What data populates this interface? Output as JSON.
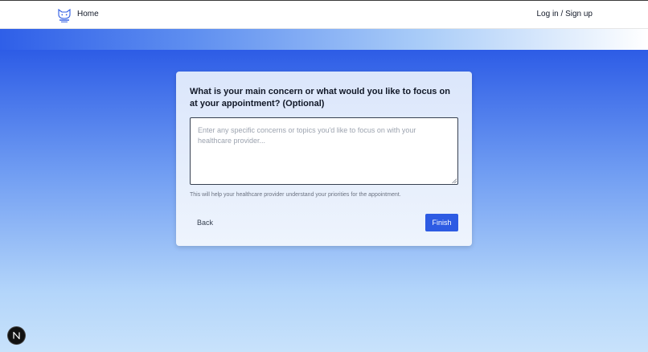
{
  "nav": {
    "logo_icon": "cat-logo-icon",
    "home_label": "Home",
    "login_label": "Log in / Sign up"
  },
  "card": {
    "title": "What is your main concern or what would you like to focus on at your appointment? (Optional)",
    "input_value": "",
    "input_placeholder": "Enter any specific concerns or topics you'd like to focus on with your healthcare provider...",
    "help_text": "This will help your healthcare provider understand your priorities for the appointment.",
    "back_label": "Back",
    "finish_label": "Finish"
  },
  "badge": {
    "icon": "nextjs-n-icon"
  },
  "colors": {
    "accent": "#2d5be3",
    "background_top": "#2d5ce6",
    "background_bottom": "#c8e2fb",
    "card_bg": "#eef4fd"
  }
}
